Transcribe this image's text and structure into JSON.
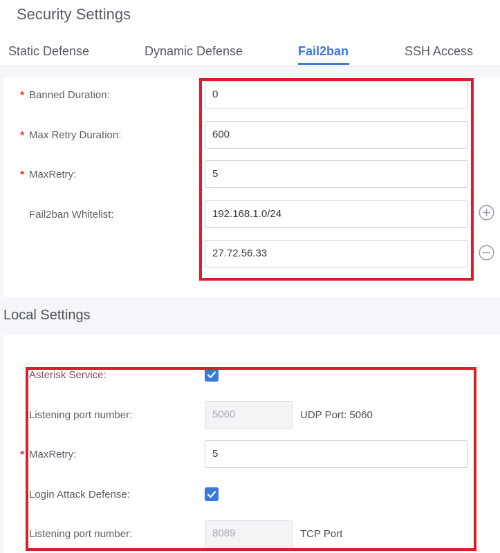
{
  "page_title": "Security Settings",
  "tabs": [
    {
      "label": "Static Defense",
      "active": false
    },
    {
      "label": "Dynamic Defense",
      "active": false
    },
    {
      "label": "Fail2ban",
      "active": true
    },
    {
      "label": "SSH Access",
      "active": false
    }
  ],
  "fail2ban": {
    "banned_duration": {
      "label": "Banned Duration",
      "required": true,
      "value": "0"
    },
    "max_retry_duration": {
      "label": "Max Retry Duration",
      "required": true,
      "value": "600"
    },
    "max_retry": {
      "label": "MaxRetry",
      "required": true,
      "value": "5"
    },
    "whitelist": {
      "label": "Fail2ban Whitelist",
      "values": [
        "192.168.1.0/24",
        "27.72.56.33"
      ]
    }
  },
  "local_settings": {
    "title": "Local Settings",
    "asterisk_service": {
      "label": "Asterisk Service",
      "checked": true
    },
    "asterisk_port": {
      "label": "Listening port number",
      "value": "5060",
      "note": "UDP Port: 5060"
    },
    "max_retry": {
      "label": "MaxRetry",
      "required": true,
      "value": "5"
    },
    "login_attack_defense": {
      "label": "Login Attack Defense",
      "checked": true
    },
    "login_port": {
      "label": "Listening port number",
      "value": "8089",
      "note": "TCP Port"
    }
  },
  "label_suffix": ":",
  "required_mark": "*",
  "colors": {
    "accent": "#3a78d9",
    "required": "#e53935",
    "highlight_box": "#d9202a",
    "background": "#f4f6fa"
  },
  "icons": {
    "add_whitelist": "plus-circle-icon",
    "remove_whitelist": "minus-circle-icon",
    "checkbox": "check-icon"
  }
}
